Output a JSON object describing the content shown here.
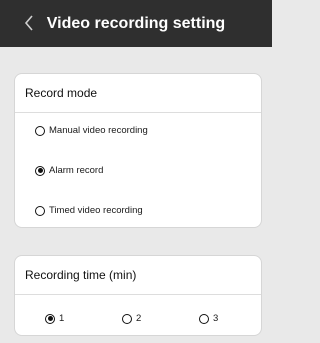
{
  "header": {
    "title": "Video recording setting",
    "back_icon": "chevron-left-icon"
  },
  "record_mode": {
    "title": "Record mode",
    "options": [
      {
        "label": "Manual video recording",
        "selected": false
      },
      {
        "label": "Alarm record",
        "selected": true
      },
      {
        "label": "Timed video recording",
        "selected": false
      }
    ]
  },
  "recording_time": {
    "title": "Recording time (min)",
    "options": [
      {
        "label": "1",
        "selected": true
      },
      {
        "label": "2",
        "selected": false
      },
      {
        "label": "3",
        "selected": false
      }
    ]
  },
  "colors": {
    "header_bg": "#2f2f2f",
    "page_bg": "#e9e9e9",
    "card_bg": "#ffffff"
  }
}
